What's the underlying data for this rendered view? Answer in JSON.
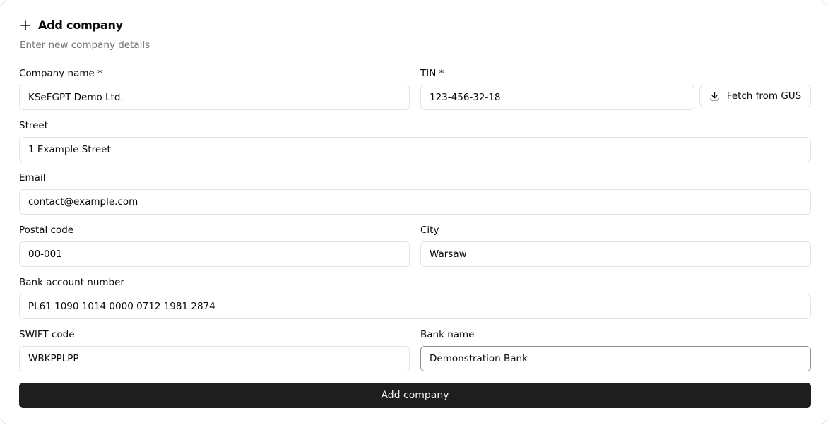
{
  "header": {
    "title": "Add company",
    "subtitle": "Enter new company details",
    "icon": "plus-icon"
  },
  "fields": {
    "company_name": {
      "label": "Company name *",
      "value": "KSeFGPT Demo Ltd."
    },
    "tin": {
      "label": "TIN *",
      "value": "123-456-32-18"
    },
    "street": {
      "label": "Street",
      "value": "1 Example Street"
    },
    "email": {
      "label": "Email",
      "value": "contact@example.com"
    },
    "postal_code": {
      "label": "Postal code",
      "value": "00-001"
    },
    "city": {
      "label": "City",
      "value": "Warsaw"
    },
    "bank_account": {
      "label": "Bank account number",
      "value": "PL61 1090 1014 0000 0712 1981 2874"
    },
    "swift": {
      "label": "SWIFT code",
      "value": "WBKPPLPP"
    },
    "bank_name": {
      "label": "Bank name",
      "value": "Demonstration Bank"
    }
  },
  "fetch_button": {
    "label": "Fetch from GUS",
    "icon": "download-icon"
  },
  "submit_button": {
    "label": "Add company"
  },
  "colors": {
    "primary_button_bg": "#1e1e1f",
    "border": "#e4e4e7",
    "muted_text": "#71717a"
  }
}
